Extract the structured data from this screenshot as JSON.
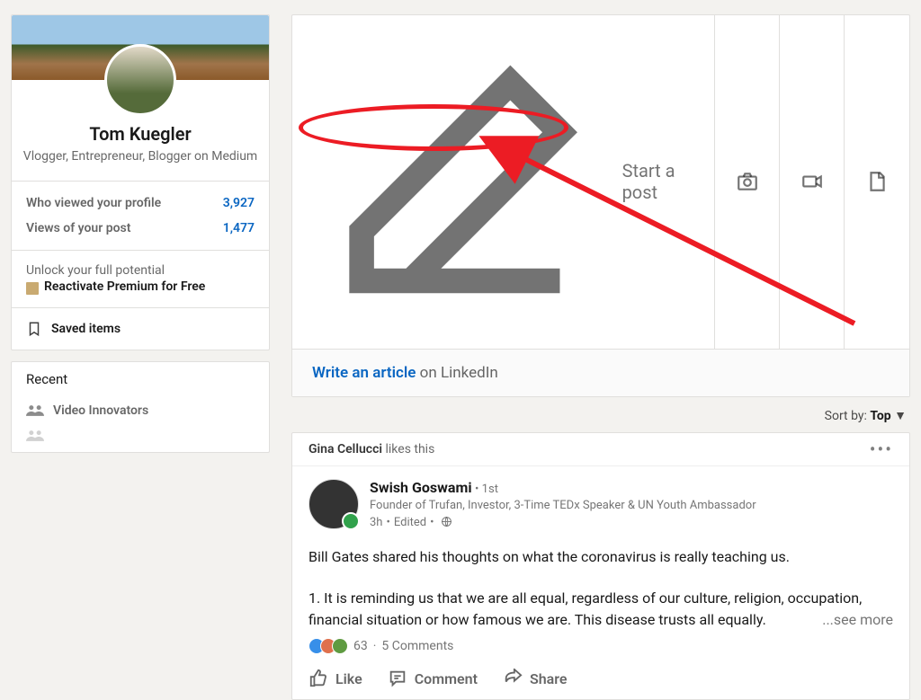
{
  "sidebar": {
    "profile": {
      "name": "Tom Kuegler",
      "headline": "Vlogger, Entrepreneur, Blogger on Medium"
    },
    "stats": [
      {
        "label": "Who viewed your profile",
        "value": "3,927"
      },
      {
        "label": "Views of your post",
        "value": "1,477"
      }
    ],
    "premium": {
      "top": "Unlock your full potential",
      "cta": "Reactivate Premium for Free"
    },
    "saved_label": "Saved items",
    "recent_title": "Recent",
    "recent_items": [
      "Video Innovators"
    ]
  },
  "share": {
    "start_label": "Start a post",
    "write_link": "Write an article",
    "write_suffix": "on LinkedIn"
  },
  "sort": {
    "label": "Sort by:",
    "value": "Top"
  },
  "feed": {
    "header_liker": "Gina Cellucci",
    "header_suffix": "likes this",
    "author": {
      "name": "Swish Goswami",
      "degree": "1st",
      "headline": "Founder of Trufan, Investor, 3-Time TEDx Speaker & UN Youth Ambassador",
      "time": "3h",
      "edited": "Edited"
    },
    "body_lines": [
      "Bill Gates shared his thoughts on what the coronavirus is really teaching us.",
      "1. It is reminding us that we are all equal, regardless of our culture, religion, occupation, financial situation or how famous we are. This disease trusts all equally."
    ],
    "see_more": "...see more",
    "reactions": {
      "count": "63",
      "comments": "5 Comments"
    },
    "actions": {
      "like": "Like",
      "comment": "Comment",
      "share": "Share"
    }
  }
}
